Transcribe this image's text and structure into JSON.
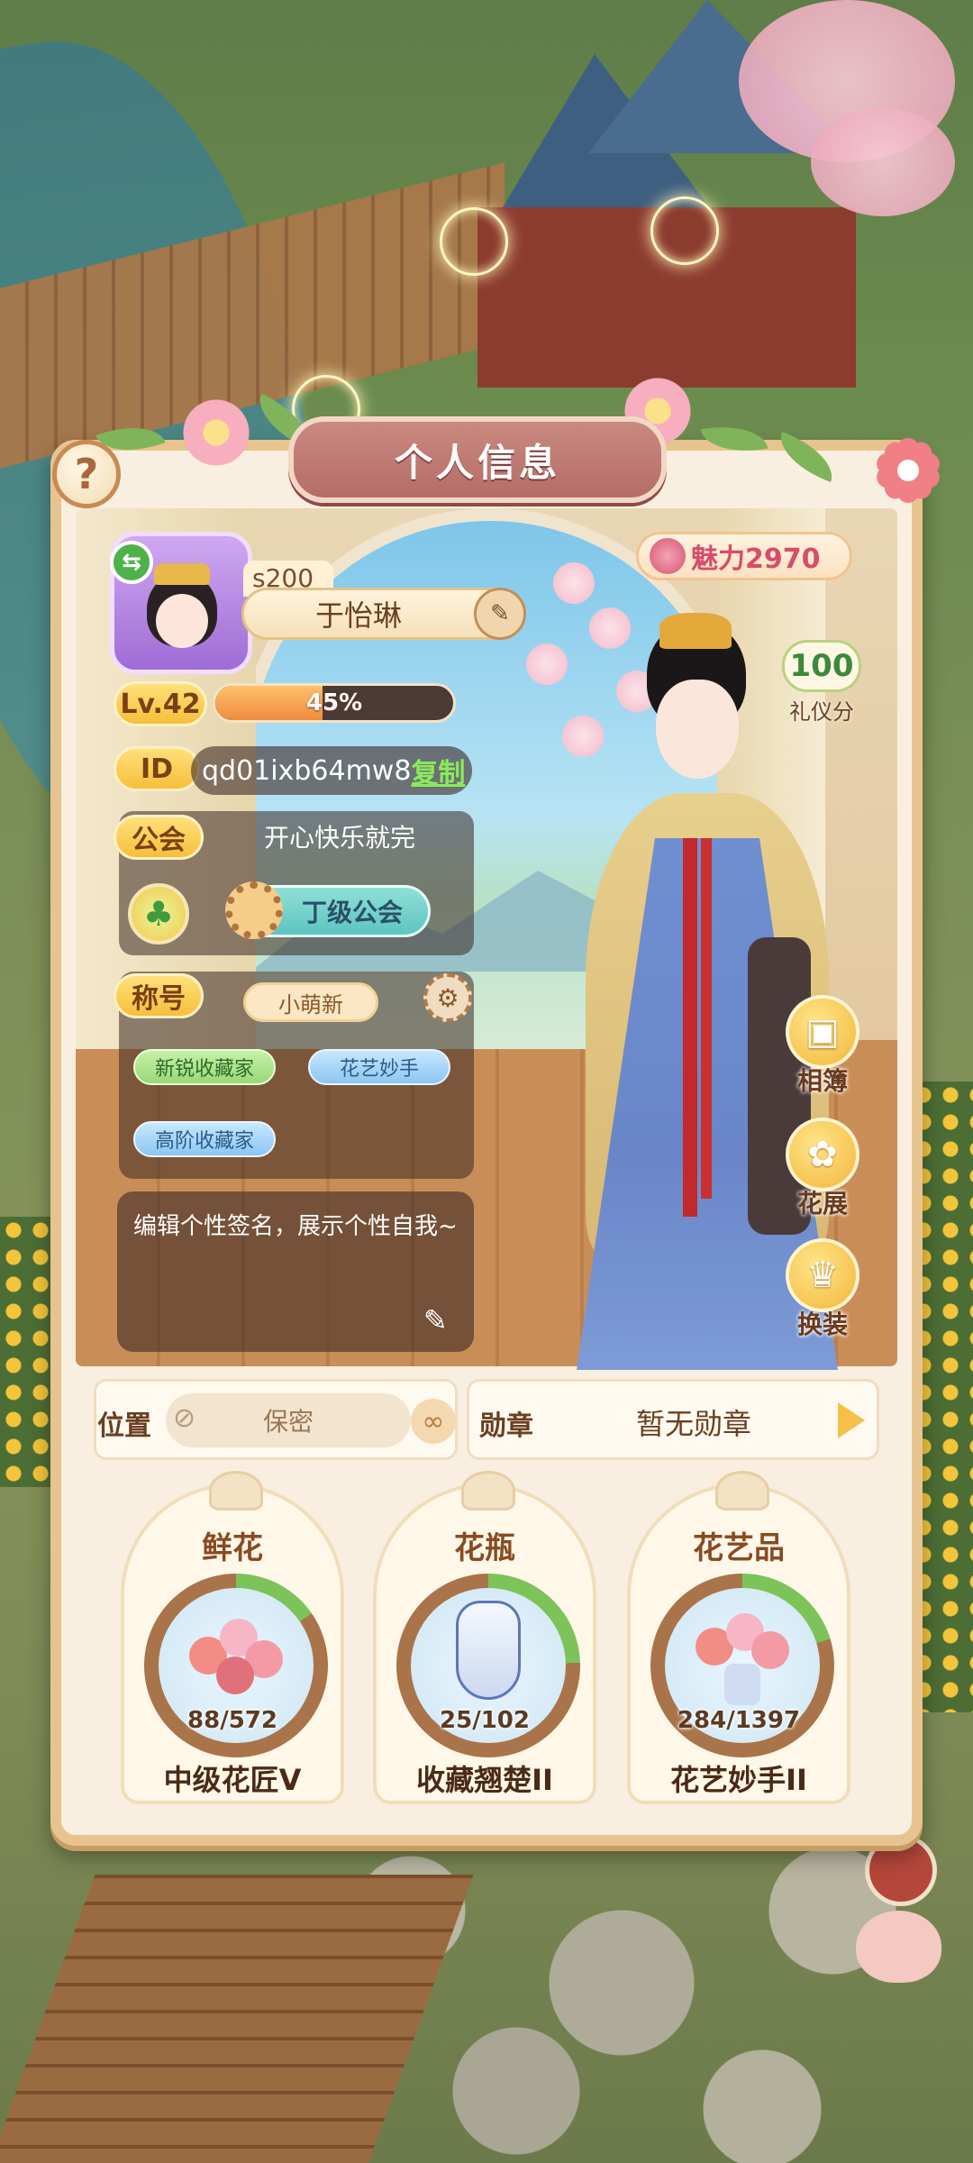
{
  "header": {
    "title": "个人信息",
    "help_label": "?"
  },
  "profile": {
    "server_tag": "s200",
    "name": "于怡琳",
    "level_label": "Lv.42",
    "level_progress": 0.45,
    "level_progress_text": "45%",
    "id_label": "ID",
    "id_value": "qd01ixb64mw8",
    "copy_label": "复制",
    "guild_label": "公会",
    "guild_motto": "开心快乐就完",
    "guild_name": "丁级公会",
    "title_label": "称号",
    "current_title": "小萌新",
    "titles": [
      "新锐收藏家",
      "花艺妙手",
      "高阶收藏家"
    ],
    "signature": "编辑个性签名，展示个性自我~"
  },
  "stats": {
    "charm_label": "魅力2970",
    "etiquette_value": "100",
    "etiquette_label": "礼仪分"
  },
  "side_buttons": [
    {
      "label": "相簿",
      "icon": "photo-album-icon"
    },
    {
      "label": "花展",
      "icon": "flower-show-icon"
    },
    {
      "label": "换装",
      "icon": "outfit-icon"
    }
  ],
  "location": {
    "label": "位置",
    "value": "保密"
  },
  "medal": {
    "label": "勋章",
    "value": "暂无勋章"
  },
  "collections": [
    {
      "title": "鲜花",
      "progress": "88/572",
      "current": 88,
      "total": 572,
      "rank": "中级花匠V"
    },
    {
      "title": "花瓶",
      "progress": "25/102",
      "current": 25,
      "total": 102,
      "rank": "收藏翘楚II"
    },
    {
      "title": "花艺品",
      "progress": "284/1397",
      "current": 284,
      "total": 1397,
      "rank": "花艺妙手II"
    }
  ],
  "colors": {
    "panel": "#f8efe0",
    "accent_gold": "#f6bf3a",
    "ring_progress": "#7cc35a",
    "ring_track": "#a9744a",
    "charm": "#d64d6b"
  }
}
